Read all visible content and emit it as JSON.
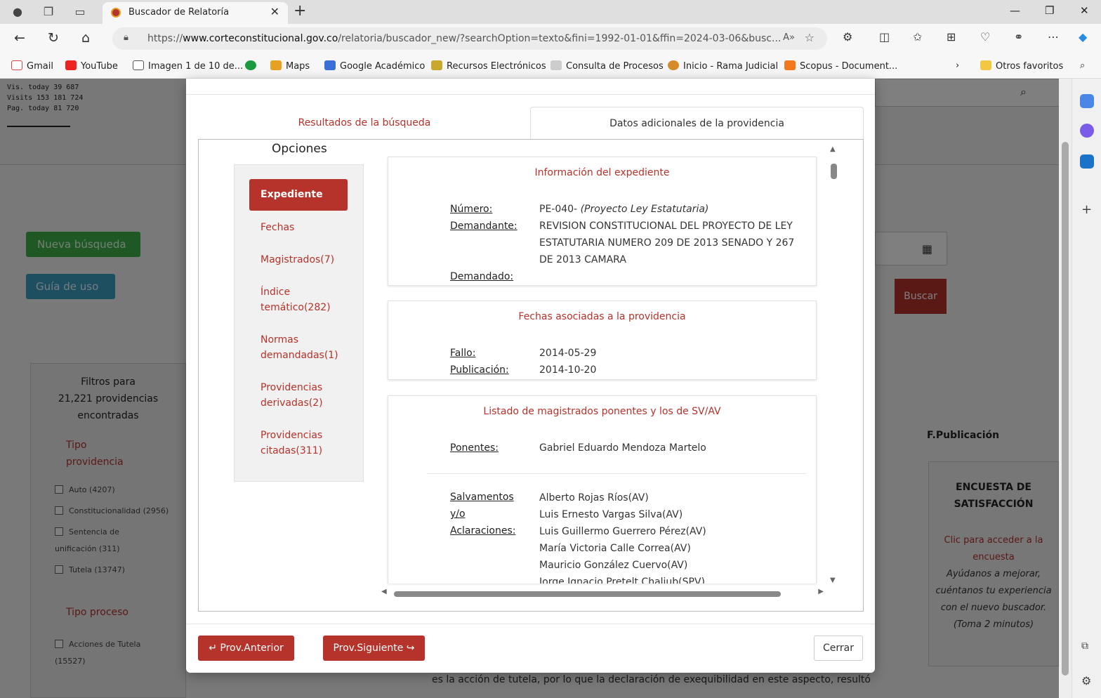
{
  "browser": {
    "tab_title": "Buscador de Relatoría",
    "url_prefix": "https://",
    "url_domain": "www.corteconstitucional.gov.co",
    "url_path": "/relatoria/buscador_new/?searchOption=texto&fini=1992-01-01&ffin=2024-03-06&busc...",
    "favorites": [
      "Gmail",
      "YouTube",
      "Imagen 1 de 10 de...",
      "Maps",
      "Google Académico",
      "Recursos Electrónicos",
      "Consulta de Procesos",
      "Inicio - Rama Judicial",
      "Scopus - Document..."
    ],
    "other_favorites": "Otros favoritos"
  },
  "background": {
    "visits_lines": [
      "Vis. today     39 687",
      "Visits    153 181 724",
      "Pag. today     81 720"
    ],
    "nueva_busqueda": "Nueva búsqueda",
    "guia_uso": "Guía de uso",
    "filters_title": [
      "Filtros para",
      "21,221 providencias",
      "encontradas"
    ],
    "tipo_providencia": "Tipo providencia",
    "checkboxes": [
      "Auto (4207)",
      "Constitucionalidad (2956)",
      "Sentencia de unificación (311)",
      "Tutela (13747)"
    ],
    "tipo_proceso": "Tipo proceso",
    "acciones": "Acciones de Tutela (15527)",
    "buscar": "Buscar",
    "fpublicacion": "F.Publicación",
    "encuesta_title": "ENCUESTA DE SATISFACCIÓN",
    "encuesta_link": "Clic para acceder a la encuesta",
    "encuesta_italic": "Ayúdanos a mejorar, cuéntanos tu experiencia con el nuevo buscador. (Toma 2 minutos)",
    "bottom_text": "es la acción de tutela, por lo que la declaración de exequibilidad en este aspecto, resultó"
  },
  "modal": {
    "tab_results": "Resultados de la búsqueda",
    "tab_extra": "Datos adicionales de la providencia",
    "options_title": "Opciones",
    "options": [
      {
        "label": "Expediente"
      },
      {
        "label": "Fechas"
      },
      {
        "label": "Magistrados(7)"
      },
      {
        "label": "Índice temático(282)"
      },
      {
        "label": "Normas demandadas(1)"
      },
      {
        "label": "Providencias derivadas(2)"
      },
      {
        "label": "Providencias citadas(311)"
      }
    ],
    "expediente": {
      "title": "Información del expediente",
      "numero_label": "Número:",
      "numero_value": "PE-040- ",
      "numero_italic": "(Proyecto Ley Estatutaria)",
      "demandante_label": "Demandante:",
      "demandante_value": "REVISION CONSTITUCIONAL DEL PROYECTO DE LEY ESTATUTARIA NUMERO 209 DE 2013 SENADO Y 267 DE 2013 CAMARA",
      "demandado_label": "Demandado:"
    },
    "fechas": {
      "title": "Fechas asociadas a la providencia",
      "fallo_label": "Fallo:",
      "fallo_value": "2014-05-29",
      "publicacion_label": "Publicación:",
      "publicacion_value": "2014-10-20"
    },
    "magistrados": {
      "title": "Listado de magistrados ponentes y los de SV/AV",
      "ponentes_label": "Ponentes:",
      "ponentes_value": "Gabriel Eduardo Mendoza Martelo",
      "salv_label_1": "Salvamentos",
      "salv_label_2": "y/o",
      "salv_label_3": "Aclaraciones:",
      "salvamentos": [
        "Alberto Rojas Ríos(AV)",
        "Luis Ernesto Vargas Silva(AV)",
        "Luis Guillermo Guerrero Pérez(AV)",
        "María Victoria Calle Correa(AV)",
        "Mauricio González Cuervo(AV)",
        "Jorge Ignacio Pretelt Chaljub(SPV)"
      ]
    },
    "btn_prev": "Prov.Anterior",
    "btn_next": "Prov.Siguiente",
    "btn_close": "Cerrar"
  }
}
